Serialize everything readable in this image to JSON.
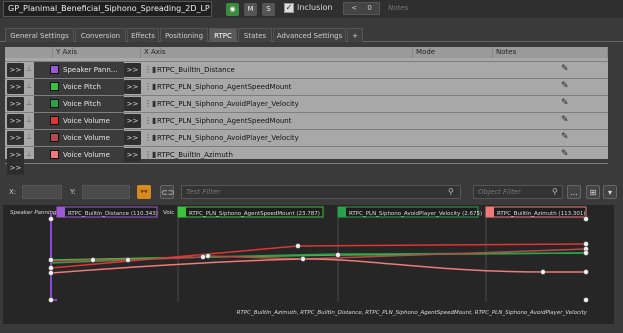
{
  "header": {
    "object_name": "GP_Planimal_Beneficial_Siphono_Spreading_2D_LP",
    "m_label": "M",
    "s_label": "S",
    "inclusion_label": "Inclusion",
    "ref_count": "0",
    "notes_placeholder": "Notes"
  },
  "tabs": [
    {
      "label": "General Settings"
    },
    {
      "label": "Conversion"
    },
    {
      "label": "Effects"
    },
    {
      "label": "Positioning"
    },
    {
      "label": "RTPC"
    },
    {
      "label": "States"
    },
    {
      "label": "Advanced Settings"
    },
    {
      "label": "+"
    }
  ],
  "active_tab": "RTPC",
  "grid": {
    "headers": {
      "y_axis": "Y Axis",
      "x_axis": "X Axis",
      "mode": "Mode",
      "notes": "Notes"
    },
    "expand_label": ">>",
    "rows": [
      {
        "y": "Speaker Panning / Mixing Balance",
        "y_display": "Speaker Pann...",
        "color": "#9b59d6",
        "x": "RTPC_BuiltIn_Distance"
      },
      {
        "y": "Voice Pitch",
        "y_display": "Voice Pitch",
        "color": "#3cc23c",
        "x": "RTPC_PLN_Siphono_AgentSpeedMount"
      },
      {
        "y": "Voice Pitch",
        "y_display": "Voice Pitch",
        "color": "#2aa14a",
        "x": "RTPC_PLN_Siphono_AvoidPlayer_Velocity"
      },
      {
        "y": "Voice Volume",
        "y_display": "Voice Volume",
        "color": "#e03535",
        "x": "RTPC_PLN_Siphono_AgentSpeedMount"
      },
      {
        "y": "Voice Volume",
        "y_display": "Voice Volume",
        "color": "#b54a4a",
        "x": "RTPC_PLN_Siphono_AvoidPlayer_Velocity"
      },
      {
        "y": "Voice Volume",
        "y_display": "Voice Volume",
        "color": "#f07a7a",
        "x": "RTPC_BuiltIn_Azimuth"
      }
    ]
  },
  "toolbar": {
    "x_label": "X:",
    "y_label": "Y:",
    "test_filter_placeholder": "Test Filter",
    "object_filter_placeholder": "Object Filter",
    "more_label": "..."
  },
  "graph": {
    "left_label": "Speaker Panning",
    "left_label_truncated": "Voic",
    "segments": [
      {
        "label": "RTPC_BuiltIn_Distance (110.343)",
        "color": "#9b59d6"
      },
      {
        "label": "RTPC_PLN_Siphono_AgentSpeedMount (23.787)",
        "color": "#3cc23c"
      },
      {
        "label": "RTPC_PLN_Siphono_AvoidPlayer_Velocity (2.675)",
        "color": "#2aa14a"
      },
      {
        "label": "RTPC_BuiltIn_Azimuth (113.301)",
        "color": "#f07a7a"
      }
    ],
    "footer": "RTPC_BuiltIn_Azimuth, RTPC_BuiltIn_Distance, RTPC_PLN_Siphono_AgentSpeedMount, RTPC_PLN_Siphono_AvoidPlayer_Velocity"
  }
}
